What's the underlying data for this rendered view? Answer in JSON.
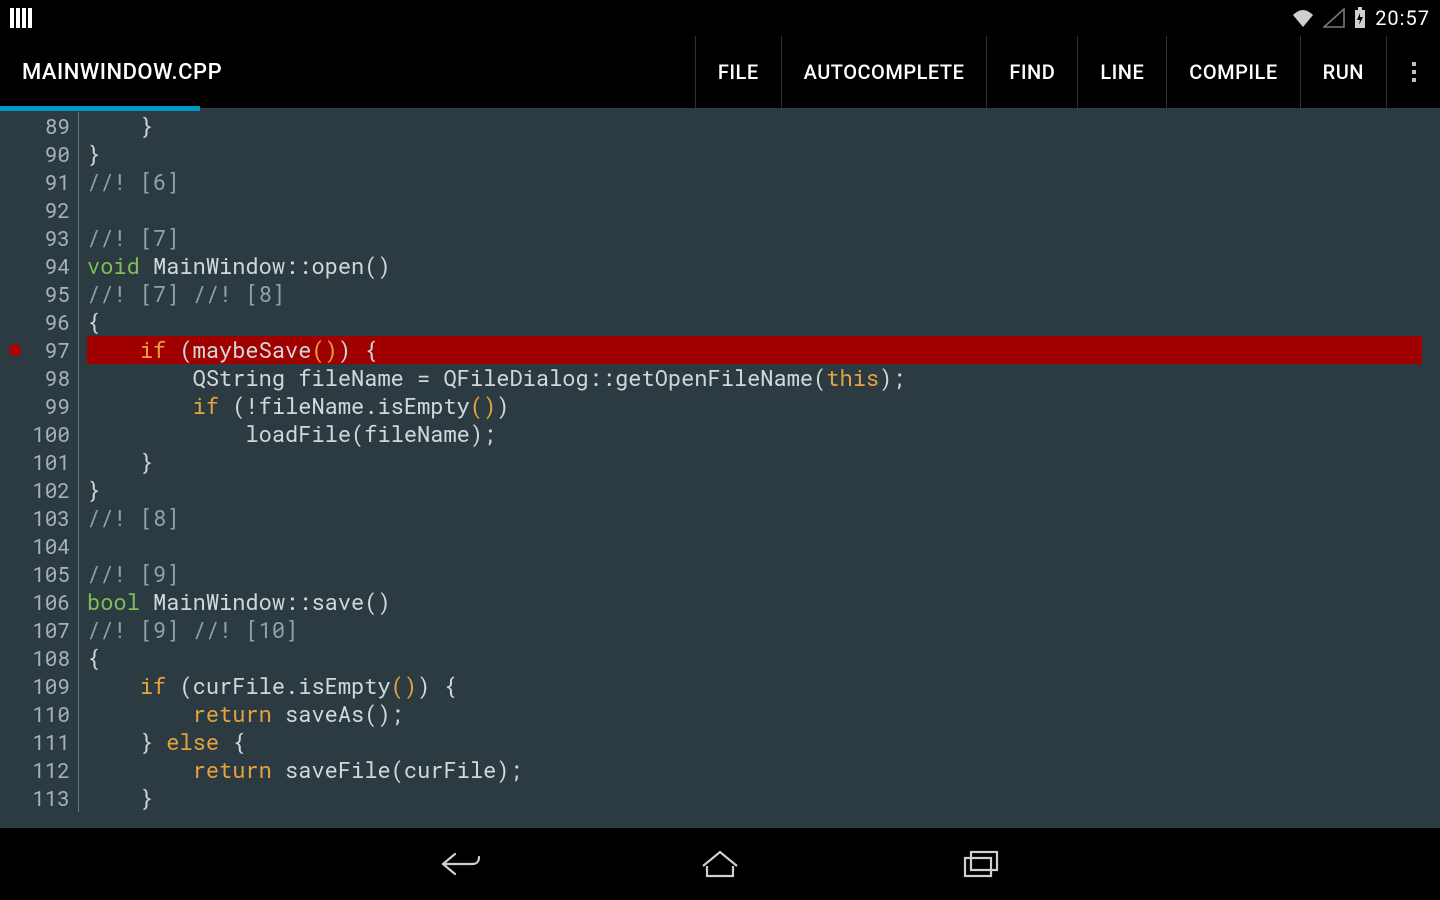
{
  "status": {
    "clock": "20:57"
  },
  "actionbar": {
    "title": "MAINWINDOW.CPP",
    "items": [
      "FILE",
      "AUTOCOMPLETE",
      "FIND",
      "LINE",
      "COMPILE",
      "RUN"
    ]
  },
  "editor": {
    "breakpoint_line": 97,
    "highlight_line": 97,
    "lines": [
      {
        "n": 89,
        "tokens": [
          [
            "plain",
            "    }"
          ]
        ]
      },
      {
        "n": 90,
        "tokens": [
          [
            "plain",
            "}"
          ]
        ]
      },
      {
        "n": 91,
        "tokens": [
          [
            "comment",
            "//! [6]"
          ]
        ]
      },
      {
        "n": 92,
        "tokens": [
          [
            "plain",
            ""
          ]
        ]
      },
      {
        "n": 93,
        "tokens": [
          [
            "comment",
            "//! [7]"
          ]
        ]
      },
      {
        "n": 94,
        "tokens": [
          [
            "type",
            "void"
          ],
          [
            "plain",
            " MainWindow::open()"
          ]
        ]
      },
      {
        "n": 95,
        "tokens": [
          [
            "comment",
            "//! [7] //! [8]"
          ]
        ]
      },
      {
        "n": 96,
        "tokens": [
          [
            "plain",
            "{"
          ]
        ]
      },
      {
        "n": 97,
        "tokens": [
          [
            "plain",
            "    "
          ],
          [
            "keyword",
            "if"
          ],
          [
            "plain",
            " (maybeSave"
          ],
          [
            "paren",
            "()"
          ],
          [
            "plain",
            ") {"
          ]
        ]
      },
      {
        "n": 98,
        "tokens": [
          [
            "plain",
            "        QString fileName = QFileDialog::getOpenFileName("
          ],
          [
            "keyword",
            "this"
          ],
          [
            "plain",
            ");"
          ]
        ]
      },
      {
        "n": 99,
        "tokens": [
          [
            "plain",
            "        "
          ],
          [
            "keyword",
            "if"
          ],
          [
            "plain",
            " (!fileName.isEmpty"
          ],
          [
            "paren",
            "()"
          ],
          [
            "plain",
            ")"
          ]
        ]
      },
      {
        "n": 100,
        "tokens": [
          [
            "plain",
            "            loadFile(fileName);"
          ]
        ]
      },
      {
        "n": 101,
        "tokens": [
          [
            "plain",
            "    }"
          ]
        ]
      },
      {
        "n": 102,
        "tokens": [
          [
            "plain",
            "}"
          ]
        ]
      },
      {
        "n": 103,
        "tokens": [
          [
            "comment",
            "//! [8]"
          ]
        ]
      },
      {
        "n": 104,
        "tokens": [
          [
            "plain",
            ""
          ]
        ]
      },
      {
        "n": 105,
        "tokens": [
          [
            "comment",
            "//! [9]"
          ]
        ]
      },
      {
        "n": 106,
        "tokens": [
          [
            "type",
            "bool"
          ],
          [
            "plain",
            " MainWindow::save()"
          ]
        ]
      },
      {
        "n": 107,
        "tokens": [
          [
            "comment",
            "//! [9] //! [10]"
          ]
        ]
      },
      {
        "n": 108,
        "tokens": [
          [
            "plain",
            "{"
          ]
        ]
      },
      {
        "n": 109,
        "tokens": [
          [
            "plain",
            "    "
          ],
          [
            "keyword",
            "if"
          ],
          [
            "plain",
            " (curFile.isEmpty"
          ],
          [
            "paren",
            "()"
          ],
          [
            "plain",
            ") {"
          ]
        ]
      },
      {
        "n": 110,
        "tokens": [
          [
            "plain",
            "        "
          ],
          [
            "keyword",
            "return"
          ],
          [
            "plain",
            " saveAs();"
          ]
        ]
      },
      {
        "n": 111,
        "tokens": [
          [
            "plain",
            "    } "
          ],
          [
            "keyword",
            "else"
          ],
          [
            "plain",
            " {"
          ]
        ]
      },
      {
        "n": 112,
        "tokens": [
          [
            "plain",
            "        "
          ],
          [
            "keyword",
            "return"
          ],
          [
            "plain",
            " saveFile(curFile);"
          ]
        ]
      },
      {
        "n": 113,
        "tokens": [
          [
            "plain",
            "    }"
          ]
        ]
      }
    ]
  }
}
